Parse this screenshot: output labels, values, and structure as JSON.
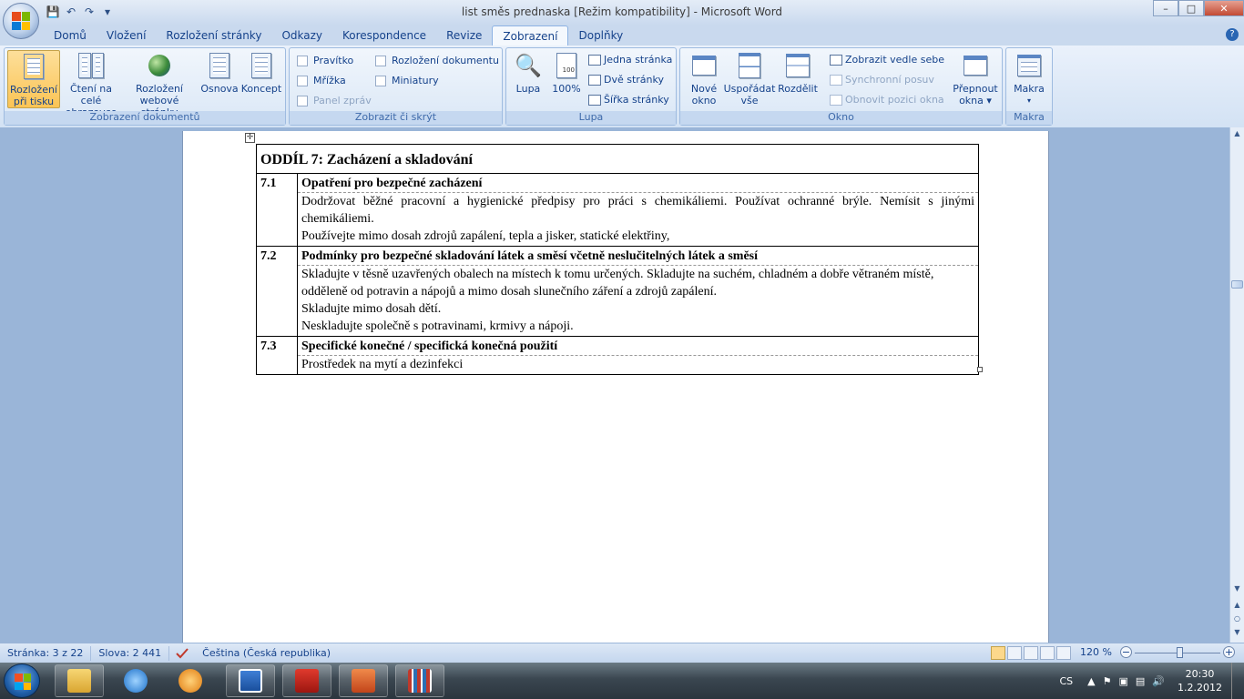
{
  "window": {
    "title": "list směs prednaska [Režim kompatibility] - Microsoft Word",
    "minimize": "–",
    "maximize": "□",
    "close": "✕"
  },
  "qat": {
    "save": "💾",
    "undo": "↶",
    "redo": "↷",
    "more": "▾"
  },
  "tabs": [
    "Domů",
    "Vložení",
    "Rozložení stránky",
    "Odkazy",
    "Korespondence",
    "Revize",
    "Zobrazení",
    "Doplňky"
  ],
  "active_tab": "Zobrazení",
  "help": "?",
  "ribbon": {
    "doc_views": {
      "label": "Zobrazení dokumentů",
      "buttons": [
        {
          "line1": "Rozložení",
          "line2": "při tisku"
        },
        {
          "line1": "Čtení na celé",
          "line2": "obrazovce"
        },
        {
          "line1": "Rozložení",
          "line2": "webové stránky"
        },
        {
          "line1": "Osnova",
          "line2": ""
        },
        {
          "line1": "Koncept",
          "line2": ""
        }
      ]
    },
    "show_hide": {
      "label": "Zobrazit či skrýt",
      "items": [
        {
          "label": "Pravítko",
          "checked": false,
          "enabled": true
        },
        {
          "label": "Mřížka",
          "checked": false,
          "enabled": true
        },
        {
          "label": "Panel zpráv",
          "checked": false,
          "enabled": false
        },
        {
          "label": "Rozložení dokumentu",
          "checked": false,
          "enabled": true
        },
        {
          "label": "Miniatury",
          "checked": false,
          "enabled": true
        }
      ]
    },
    "zoom": {
      "label": "Lupa",
      "zoom_btn": "Lupa",
      "hundred_btn": "100%",
      "hundred_badge": "100",
      "one_page": "Jedna stránka",
      "two_pages": "Dvě stránky",
      "page_width": "Šířka stránky"
    },
    "window": {
      "label": "Okno",
      "new": {
        "line1": "Nové",
        "line2": "okno"
      },
      "arrange": {
        "line1": "Uspořádat",
        "line2": "vše"
      },
      "split": "Rozdělit",
      "side_by_side": "Zobrazit vedle sebe",
      "sync_scroll": "Synchronní posuv",
      "reset_pos": "Obnovit pozici okna",
      "switch": {
        "line1": "Přepnout",
        "line2": "okna ▾"
      }
    },
    "macros": {
      "label": "Makra",
      "btn": "Makra",
      "arrow": "▾"
    }
  },
  "document": {
    "section_title": "ODDÍL 7: Zacházení a skladování",
    "rows": [
      {
        "num": "7.1",
        "title": "Opatření pro bezpečné zacházení",
        "lines": [
          "Dodržovat běžné pracovní a hygienické předpisy pro práci s chemikáliemi. Používat ochranné brýle. Nemísit s jinými chemikáliemi.",
          "Používejte mimo dosah zdrojů zapálení, tepla a jisker, statické elektřiny,"
        ]
      },
      {
        "num": "7.2",
        "title": "Podmínky pro bezpečné skladování látek a směsí včetně neslučitelných látek a směsí",
        "lines": [
          "Skladujte v těsně uzavřených obalech na místech k tomu určených. Skladujte na suchém, chladném a dobře větraném místě, odděleně od potravin a nápojů a mimo dosah slunečního záření a zdrojů zapálení.",
          "Skladujte mimo dosah dětí.",
          "Neskladujte společně s potravinami, krmivy a nápoji."
        ]
      },
      {
        "num": "7.3",
        "title": "Specifické konečné / specifická konečná použití",
        "lines": [
          "Prostředek na mytí a dezinfekci"
        ]
      }
    ]
  },
  "scroll": {
    "up": "▲",
    "down": "▼",
    "prev": "▲",
    "select": "○",
    "next": "▼"
  },
  "status": {
    "page": "Stránka: 3 z 22",
    "words": "Slova: 2 441",
    "language": "Čeština (Česká republika)",
    "zoom": "120 %",
    "zoom_level_percent": 120,
    "minus": "−",
    "plus": "+"
  },
  "taskbar": {
    "lang": "CS",
    "time": "20:30",
    "date": "1.2.2012"
  }
}
